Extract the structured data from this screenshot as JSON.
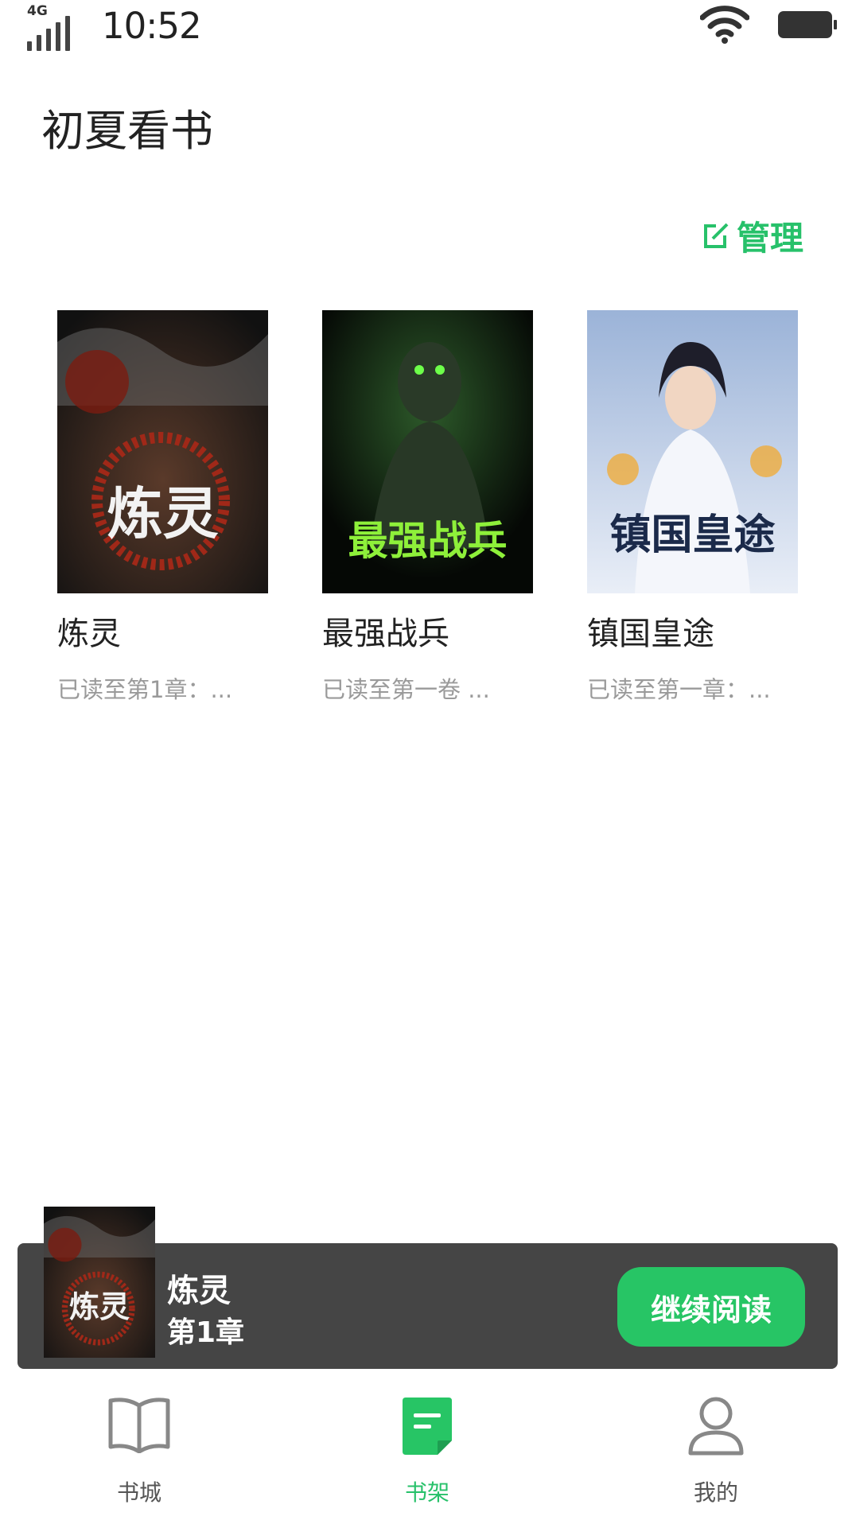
{
  "status_bar": {
    "network": "4G",
    "time": "10:52"
  },
  "app_title": "初夏看书",
  "manage_label": "管理",
  "books": [
    {
      "name": "炼灵",
      "progress": "已读至第1章：...",
      "cover_text": "炼灵"
    },
    {
      "name": "最强战兵",
      "progress": "已读至第一卷 ...",
      "cover_text": "最强战兵"
    },
    {
      "name": "镇国皇途",
      "progress": "已读至第一章：...",
      "cover_text": "镇国皇途"
    }
  ],
  "continue": {
    "title": "炼灵",
    "chapter": "第1章",
    "button": "继续阅读",
    "cover_text": "炼灵"
  },
  "tabs": [
    {
      "label": "书城",
      "icon": "book-open-icon"
    },
    {
      "label": "书架",
      "icon": "bookshelf-icon",
      "active": true
    },
    {
      "label": "我的",
      "icon": "person-icon"
    }
  ],
  "colors": {
    "accent": "#27c565",
    "bar_bg": "#454545"
  }
}
